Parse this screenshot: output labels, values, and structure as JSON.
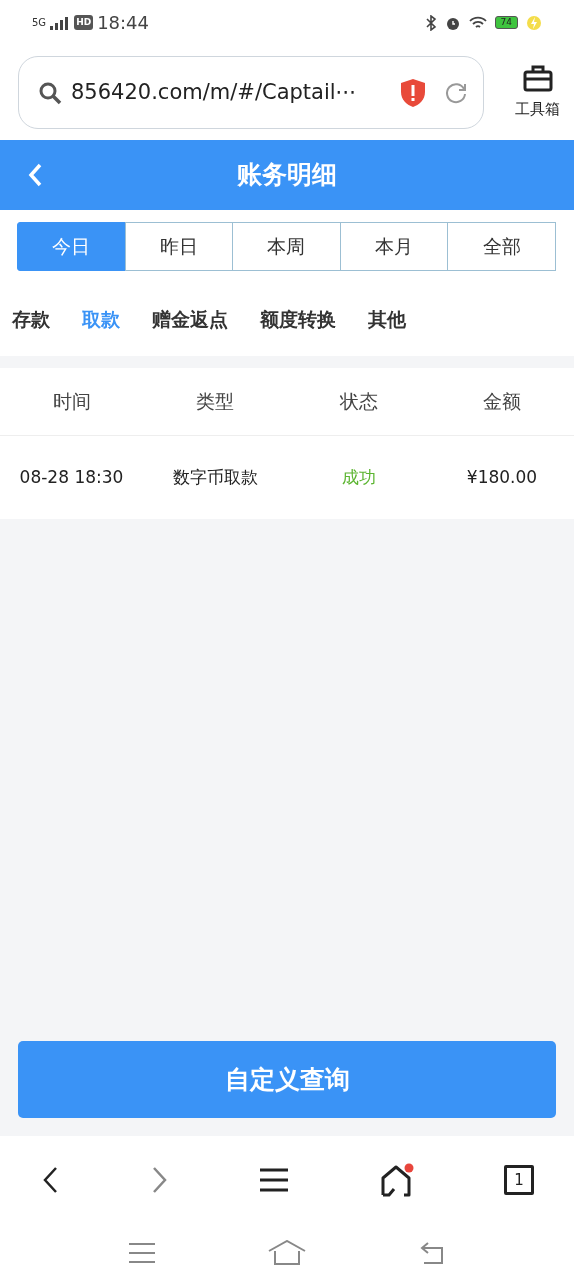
{
  "status_bar": {
    "network": "5G",
    "hd": "HD",
    "time": "18:44",
    "battery": "74"
  },
  "browser_bar": {
    "url": "856420.com/m/#/Captail⋯",
    "toolbox_label": "工具箱"
  },
  "header": {
    "title": "账务明细"
  },
  "period_tabs": [
    {
      "label": "今日",
      "selected": true
    },
    {
      "label": "昨日",
      "selected": false
    },
    {
      "label": "本周",
      "selected": false
    },
    {
      "label": "本月",
      "selected": false
    },
    {
      "label": "全部",
      "selected": false
    }
  ],
  "categories": [
    {
      "label": "存款",
      "selected": false
    },
    {
      "label": "取款",
      "selected": true
    },
    {
      "label": "赠金返点",
      "selected": false
    },
    {
      "label": "额度转换",
      "selected": false
    },
    {
      "label": "其他",
      "selected": false
    }
  ],
  "table": {
    "columns": [
      "时间",
      "类型",
      "状态",
      "金额"
    ],
    "rows": [
      {
        "time": "08-28 18:30",
        "type": "数字币取款",
        "status": "成功",
        "color": "#5cb531",
        "amount": "¥180.00"
      }
    ]
  },
  "query_button": "自定义查询",
  "browser_nav": {
    "tab_count": "1",
    "home_dot": true
  }
}
